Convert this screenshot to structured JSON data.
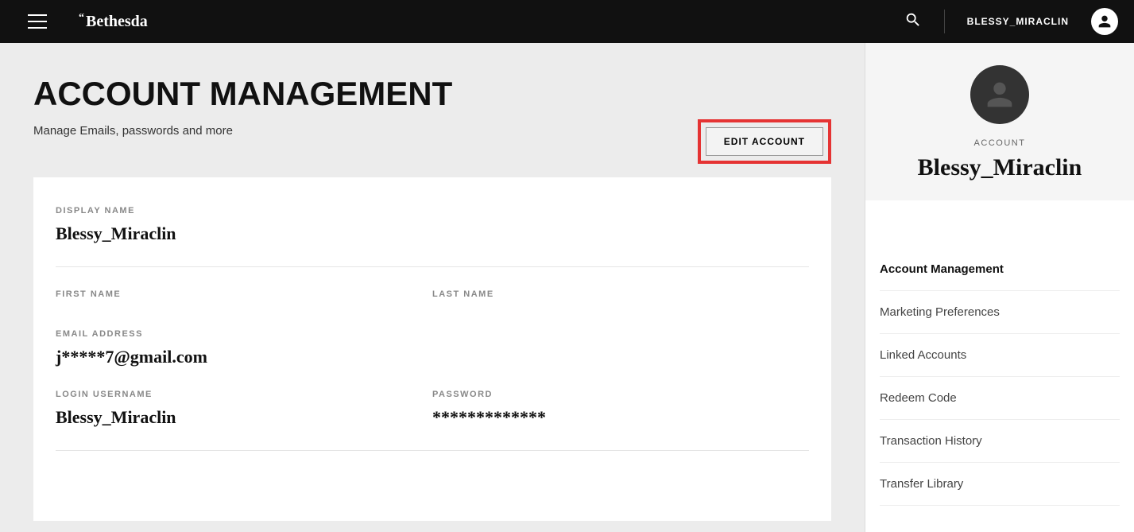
{
  "header": {
    "brand": "Bethesda",
    "username": "BLESSY_MIRACLIN"
  },
  "page": {
    "title": "ACCOUNT MANAGEMENT",
    "subtitle": "Manage Emails, passwords and more",
    "edit_button": "EDIT ACCOUNT"
  },
  "fields": {
    "display_name_label": "DISPLAY NAME",
    "display_name_value": "Blessy_Miraclin",
    "first_name_label": "FIRST NAME",
    "first_name_value": "",
    "last_name_label": "LAST NAME",
    "last_name_value": "",
    "email_label": "EMAIL ADDRESS",
    "email_value": "j*****7@gmail.com",
    "login_label": "LOGIN USERNAME",
    "login_value": "Blessy_Miraclin",
    "password_label": "PASSWORD",
    "password_value": "*************"
  },
  "sidebar": {
    "account_label": "ACCOUNT",
    "display_name": "Blessy_Miraclin",
    "nav": [
      "Account Management",
      "Marketing Preferences",
      "Linked Accounts",
      "Redeem Code",
      "Transaction History",
      "Transfer Library"
    ]
  }
}
